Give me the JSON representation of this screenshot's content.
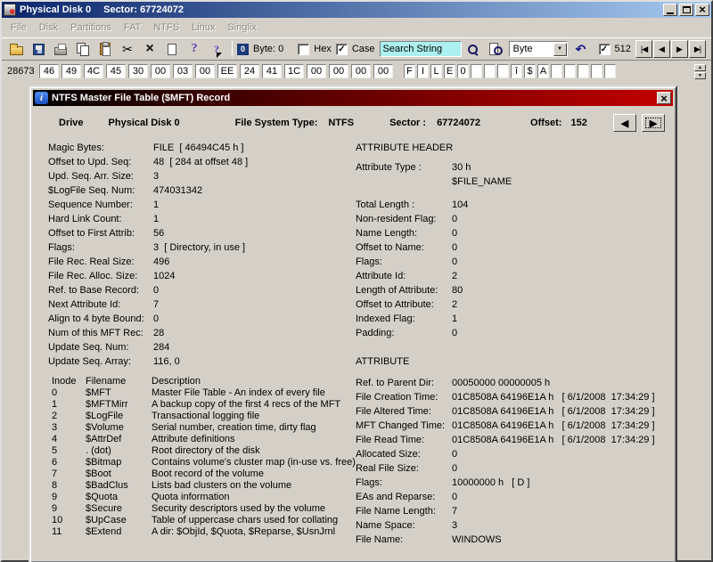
{
  "window": {
    "title_drive": "Physical Disk 0",
    "title_sector": "Sector: 67724072",
    "menu": [
      "File",
      "Disk",
      "Partitions",
      "FAT",
      "NTFS",
      "Linux",
      "Singlix"
    ],
    "toolbar": {
      "byte_indicator": "Byte: 0",
      "hex_label": "Hex",
      "case_label": "Case",
      "search_value": "Search String",
      "unit_value": "Byte",
      "block_label": "512"
    },
    "hex_row": {
      "address": "28673",
      "bytes": [
        "46",
        "49",
        "4C",
        "45",
        "30",
        "00",
        "03",
        "00",
        "EE",
        "24",
        "41",
        "1C",
        "00",
        "00",
        "00",
        "00"
      ],
      "chars": [
        "F",
        "I",
        "L",
        "E",
        "0",
        "",
        "",
        "",
        "î",
        "$",
        "A",
        "",
        "",
        "",
        "",
        ""
      ]
    }
  },
  "dialog": {
    "title": "NTFS Master File Table ($MFT) Record",
    "header": {
      "drive_label": "Drive",
      "drive_value": "Physical Disk 0",
      "fs_label": "File System Type:",
      "fs_value": "NTFS",
      "sector_label": "Sector :",
      "sector_value": "67724072",
      "offset_label": "Offset:",
      "offset_value": "152"
    },
    "left_fields": [
      {
        "label": "Magic Bytes:",
        "value": "FILE  [ 46494C45 h ]"
      },
      {
        "label": "Offset to Upd. Seq:",
        "value": "48  [ 284 at offset 48 ]"
      },
      {
        "label": "Upd. Seq. Arr. Size:",
        "value": "3"
      },
      {
        "label": "$LogFile Seq. Num:",
        "value": "474031342"
      },
      {
        "label": "Sequence Number:",
        "value": "1"
      },
      {
        "label": "Hard Link Count:",
        "value": "1"
      },
      {
        "label": "Offset to First Attrib:",
        "value": "56"
      },
      {
        "label": "Flags:",
        "value": "3  [ Directory, in use ]"
      },
      {
        "label": "File Rec. Real Size:",
        "value": "496"
      },
      {
        "label": "File Rec. Alloc. Size:",
        "value": "1024"
      },
      {
        "label": "Ref. to Base Record:",
        "value": "0"
      },
      {
        "label": "Next Attribute Id:",
        "value": "7"
      },
      {
        "label": "Align to 4 byte Bound:",
        "value": "0"
      },
      {
        "label": "Num of this MFT Rec:",
        "value": "28"
      },
      {
        "label": "Update Seq. Num:",
        "value": "284"
      },
      {
        "label": "Update Seq. Array:",
        "value": "116, 0"
      }
    ],
    "attr_header_title": "ATTRIBUTE HEADER",
    "attr_header_fields": [
      {
        "label": "Attribute Type :",
        "value": "30 h\n$FILE_NAME"
      },
      {
        "label": "Total Length :",
        "value": "104"
      },
      {
        "label": "Non-resident Flag:",
        "value": "0"
      },
      {
        "label": "Name Length:",
        "value": "0"
      },
      {
        "label": "Offset to Name:",
        "value": "0"
      },
      {
        "label": "Flags:",
        "value": "0"
      },
      {
        "label": "Attribute Id:",
        "value": "2"
      },
      {
        "label": "Length of Attribute:",
        "value": "80"
      },
      {
        "label": "Offset to Attribute:",
        "value": "2"
      },
      {
        "label": "Indexed Flag:",
        "value": "1"
      },
      {
        "label": "Padding:",
        "value": "0"
      }
    ],
    "attribute_title": "ATTRIBUTE",
    "attribute_fields": [
      {
        "label": "Ref. to Parent Dir:",
        "value": "00050000 00000005 h"
      },
      {
        "label": "File Creation Time:",
        "value": "01C8508A 64196E1A h   [ 6/1/2008  17:34:29 ]"
      },
      {
        "label": "File Altered Time:",
        "value": "01C8508A 64196E1A h   [ 6/1/2008  17:34:29 ]"
      },
      {
        "label": "MFT Changed Time:",
        "value": "01C8508A 64196E1A h   [ 6/1/2008  17:34:29 ]"
      },
      {
        "label": "File Read Time:",
        "value": "01C8508A 64196E1A h   [ 6/1/2008  17:34:29 ]"
      },
      {
        "label": "Allocated Size:",
        "value": "0"
      },
      {
        "label": "Real File Size:",
        "value": "0"
      },
      {
        "label": "Flags:",
        "value": "10000000 h   [ D ]"
      },
      {
        "label": "EAs and Reparse:",
        "value": "0"
      },
      {
        "label": "File Name Length:",
        "value": "7"
      },
      {
        "label": "Name Space:",
        "value": "3"
      },
      {
        "label": "File Name:",
        "value": "WINDOWS"
      }
    ],
    "inode_table": {
      "headers": [
        "Inode",
        "Filename",
        "Description"
      ],
      "rows": [
        [
          "0",
          "$MFT",
          "Master File Table - An index of every file"
        ],
        [
          "1",
          "$MFTMirr",
          "A backup copy of the first 4 recs of the MFT"
        ],
        [
          "2",
          "$LogFile",
          "Transactional logging file"
        ],
        [
          "3",
          "$Volume",
          "Serial number, creation time, dirty flag"
        ],
        [
          "4",
          "$AttrDef",
          "Attribute definitions"
        ],
        [
          "5",
          ". (dot)",
          "Root directory of the disk"
        ],
        [
          "6",
          "$Bitmap",
          "Contains volume's cluster map (in-use vs. free)"
        ],
        [
          "7",
          "$Boot",
          "Boot record of the volume"
        ],
        [
          "8",
          "$BadClus",
          "Lists bad clusters on the volume"
        ],
        [
          "9",
          "$Quota",
          "Quota information"
        ],
        [
          "9",
          "$Secure",
          "Security descriptors used by the volume"
        ],
        [
          "10",
          "$UpCase",
          "Table of uppercase chars used for collating"
        ],
        [
          "11",
          "$Extend",
          "A dir: $ObjId, $Quota, $Reparse, $UsnJrnl"
        ]
      ]
    }
  },
  "colors": {
    "titlebar_start": "#0A246A",
    "titlebar_end": "#A6CAF0",
    "dialog_titlebar_start": "#000000",
    "dialog_titlebar_end": "#C40000",
    "search_bg": "#ACF0F0",
    "chrome": "#D4D0C8"
  }
}
